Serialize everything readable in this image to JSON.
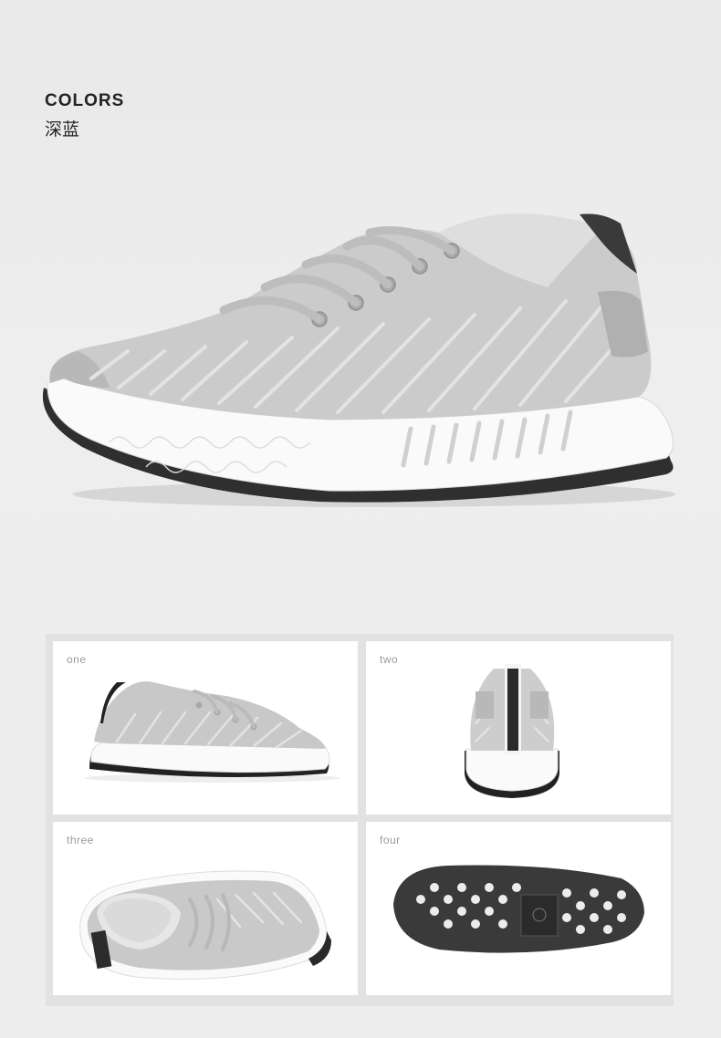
{
  "header": {
    "label": "COLORS",
    "value": "深蓝"
  },
  "gallery": {
    "cards": [
      {
        "label": "one"
      },
      {
        "label": "two"
      },
      {
        "label": "three"
      },
      {
        "label": "four"
      }
    ]
  },
  "colors": {
    "background": "#ededed",
    "upper": "#c9c9c9",
    "sole": "#ffffff",
    "outline": "#2a2a2a"
  }
}
